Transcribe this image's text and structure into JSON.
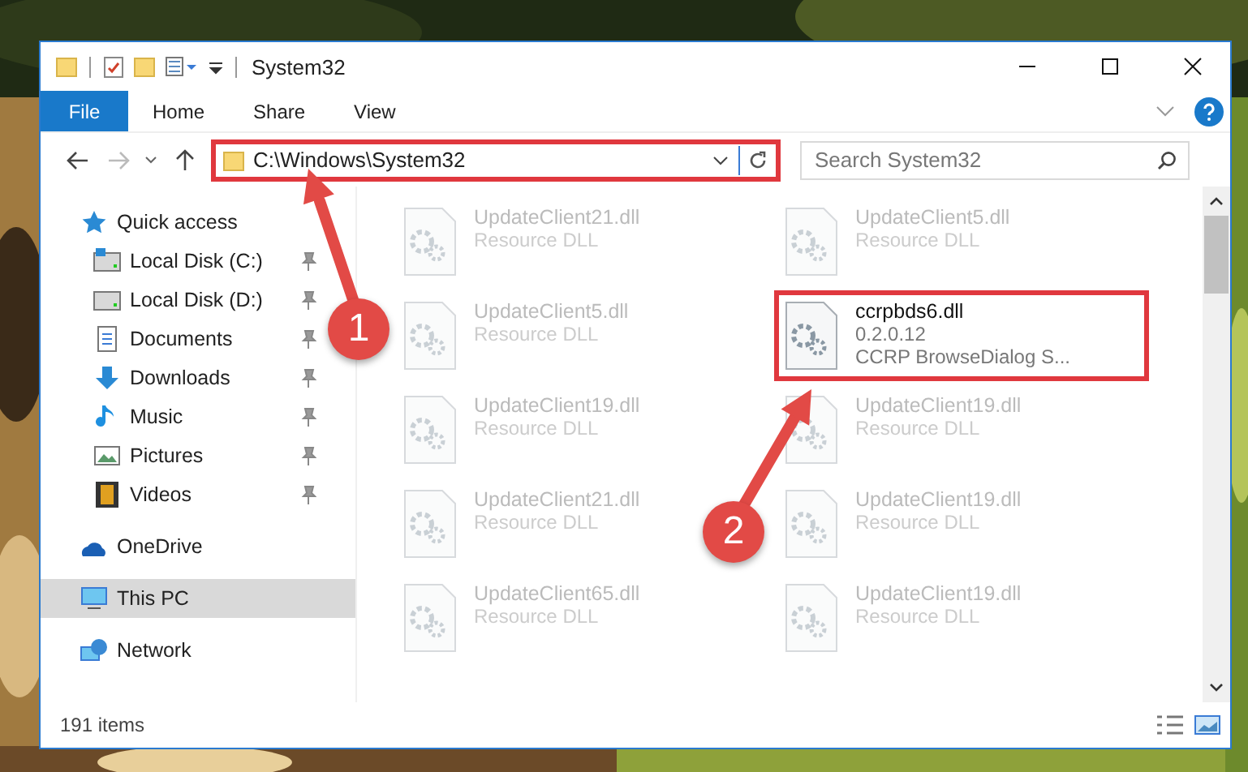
{
  "window": {
    "title": "System32"
  },
  "ribbon_tabs": [
    {
      "label": "File",
      "kind": "file"
    },
    {
      "label": "Home",
      "kind": "tab"
    },
    {
      "label": "Share",
      "kind": "tab"
    },
    {
      "label": "View",
      "kind": "tab"
    }
  ],
  "address_bar": {
    "path": "C:\\Windows\\System32",
    "highlighted": true
  },
  "search": {
    "placeholder": "Search System32"
  },
  "sidebar": {
    "items": [
      {
        "label": "Quick access",
        "selected": false,
        "children": [
          {
            "label": "Local Disk (C:)",
            "pinned": true
          },
          {
            "label": "Local Disk (D:)",
            "pinned": true
          },
          {
            "label": "Documents",
            "pinned": true
          },
          {
            "label": "Downloads",
            "pinned": true
          },
          {
            "label": "Music",
            "pinned": true
          },
          {
            "label": "Pictures",
            "pinned": true
          },
          {
            "label": "Videos",
            "pinned": true
          }
        ]
      },
      {
        "label": "OneDrive",
        "selected": false
      },
      {
        "label": "This PC",
        "selected": true
      },
      {
        "label": "Network",
        "selected": false
      }
    ]
  },
  "files": [
    {
      "name": "UpdateClient21.dll",
      "detail": "Resource DLL",
      "blurred": true,
      "highlighted": false
    },
    {
      "name": "UpdateClient5.dll",
      "detail": "Resource DLL",
      "blurred": true,
      "highlighted": false
    },
    {
      "name": "UpdateClient5.dll",
      "detail": "Resource DLL",
      "blurred": true,
      "highlighted": false
    },
    {
      "name": "ccrpbds6.dll",
      "version": "0.2.0.12",
      "detail": "CCRP BrowseDialog S...",
      "blurred": false,
      "highlighted": true
    },
    {
      "name": "UpdateClient19.dll",
      "detail": "Resource DLL",
      "blurred": true,
      "highlighted": false
    },
    {
      "name": "UpdateClient19.dll",
      "detail": "Resource DLL",
      "blurred": true,
      "highlighted": false
    },
    {
      "name": "UpdateClient21.dll",
      "detail": "Resource DLL",
      "blurred": true,
      "highlighted": false
    },
    {
      "name": "UpdateClient19.dll",
      "detail": "Resource DLL",
      "blurred": true,
      "highlighted": false
    },
    {
      "name": "UpdateClient65.dll",
      "detail": "Resource DLL",
      "blurred": true,
      "highlighted": false
    },
    {
      "name": "UpdateClient19.dll",
      "detail": "Resource DLL",
      "blurred": true,
      "highlighted": false
    }
  ],
  "status_bar": {
    "count": "191 items"
  },
  "callouts": [
    {
      "label": "1"
    },
    {
      "label": "2"
    }
  ]
}
